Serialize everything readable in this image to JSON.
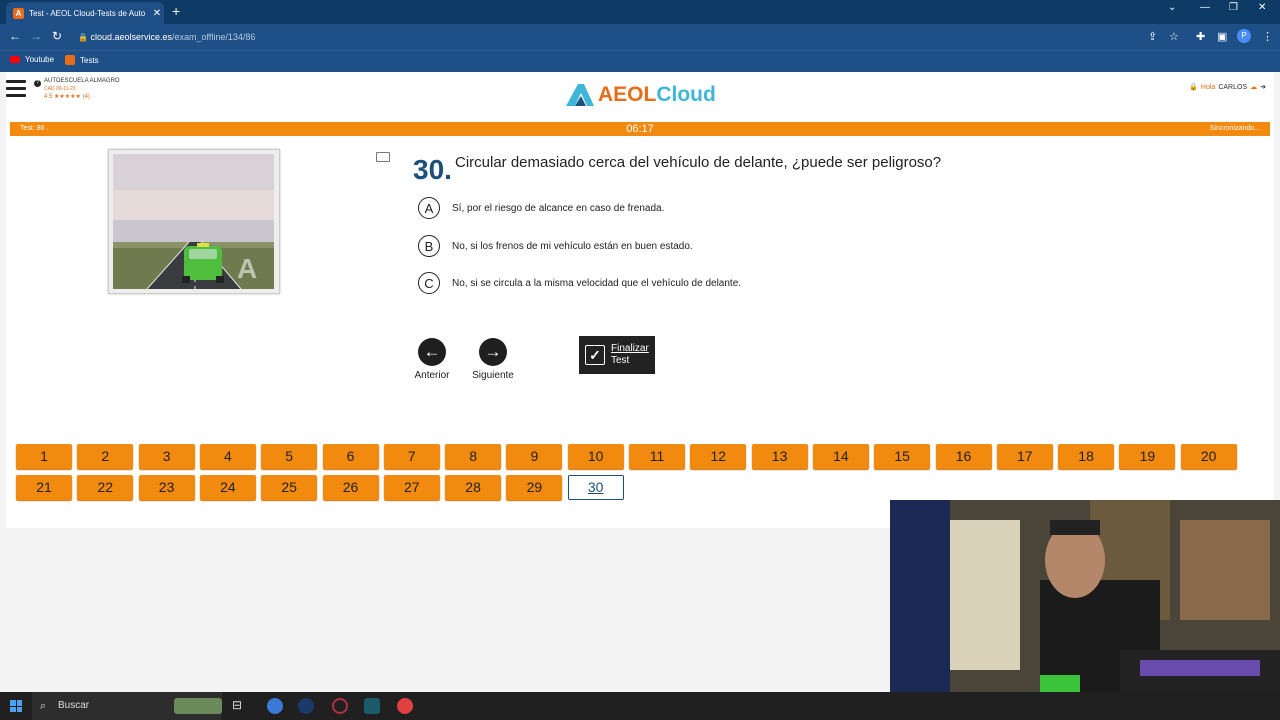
{
  "browser": {
    "tab_title": "Test - AEOL Cloud-Tests de Auto",
    "tab_favicon": "AEOL",
    "url_host": "cloud.aeolservice.es",
    "url_path": "/exam_offline/134/86",
    "profile_initial": "P",
    "bookmarks": [
      {
        "label": "Youtube",
        "icon": "youtube-icon"
      },
      {
        "label": "Tests",
        "icon": "aeol-icon"
      }
    ]
  },
  "header": {
    "school_name": "AUTOESCUELA ALMAGRO",
    "school_code": "CAD 09-11-23",
    "rating": "4.5 ★★★★★ (4)",
    "logo_text": "AEOL",
    "logo_cloud": "Cloud",
    "greeting": "Hola",
    "user_name": "CARLOS"
  },
  "status_bar": {
    "test_label": "Test: 86 .",
    "timer": "06:17",
    "sync_label": "Sincronizando..."
  },
  "question": {
    "number": "30.",
    "text": "Circular demasiado cerca del vehículo de delante, ¿puede ser peligroso?",
    "answers": [
      {
        "letter": "A",
        "text": "Sí, por el riesgo de alcance en caso de frenada."
      },
      {
        "letter": "B",
        "text": "No, si los frenos de mi vehículo están en buen estado."
      },
      {
        "letter": "C",
        "text": "No, si se circula a la misma velocidad que el vehículo de delante."
      }
    ]
  },
  "navigation": {
    "prev_label": "Anterior",
    "next_label": "Siguiente",
    "finish_label_1": "Finalizar",
    "finish_label_2": "Test"
  },
  "question_grid": {
    "numbers": [
      "1",
      "2",
      "3",
      "4",
      "5",
      "6",
      "7",
      "8",
      "9",
      "10",
      "11",
      "12",
      "13",
      "14",
      "15",
      "16",
      "17",
      "18",
      "19",
      "20",
      "21",
      "22",
      "23",
      "24",
      "25",
      "26",
      "27",
      "28",
      "29",
      "30"
    ],
    "active": "30"
  },
  "taskbar": {
    "search_label": "Buscar"
  },
  "colors": {
    "brand_orange": "#f28a0f",
    "brand_blue": "#1c4f7a",
    "logo_cyan": "#3fb6d8"
  }
}
